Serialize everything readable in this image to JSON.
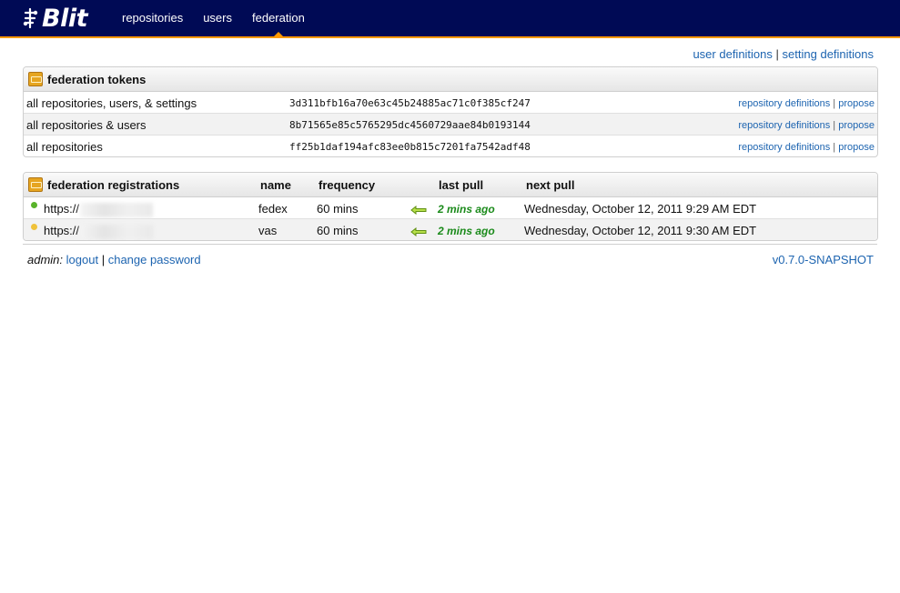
{
  "app": {
    "logo_text": "Blit"
  },
  "nav": [
    {
      "label": "repositories"
    },
    {
      "label": "users"
    },
    {
      "label": "federation",
      "active": true
    }
  ],
  "top_links": {
    "user_definitions": "user definitions",
    "separator": "|",
    "setting_definitions": "setting definitions"
  },
  "tokens": {
    "title": "federation tokens",
    "rows": [
      {
        "label": "all repositories, users, & settings",
        "token": "3d311bfb16a70e63c45b24885ac71c0f385cf247",
        "action1": "repository definitions",
        "action2": "propose"
      },
      {
        "label": "all repositories & users",
        "token": "8b71565e85c5765295dc4560729aae84b0193144",
        "action1": "repository definitions",
        "action2": "propose"
      },
      {
        "label": "all repositories",
        "token": "ff25b1daf194afc83ee0b815c7201fa7542adf48",
        "action1": "repository definitions",
        "action2": "propose"
      }
    ]
  },
  "registrations": {
    "title": "federation registrations",
    "columns": {
      "name": "name",
      "frequency": "frequency",
      "last_pull": "last pull",
      "next_pull": "next pull"
    },
    "rows": [
      {
        "status_color": "#59b32a",
        "url": "https://",
        "name": "fedex",
        "frequency": "60 mins",
        "last_pull": "2 mins ago",
        "next_pull": "Wednesday, October 12, 2011 9:29 AM EDT"
      },
      {
        "status_color": "#f0c23a",
        "url": "https://",
        "name": "vas",
        "frequency": "60 mins",
        "last_pull": "2 mins ago",
        "next_pull": "Wednesday, October 12, 2011 9:30 AM EDT"
      }
    ]
  },
  "footer": {
    "user": "admin:",
    "logout": "logout",
    "separator": "|",
    "change_password": "change password",
    "version": "v0.7.0-SNAPSHOT"
  },
  "colors": {
    "topbar": "#000a55",
    "accent": "#ff9900",
    "link": "#1d64b0",
    "pull_ok": "#1a8a1a"
  }
}
